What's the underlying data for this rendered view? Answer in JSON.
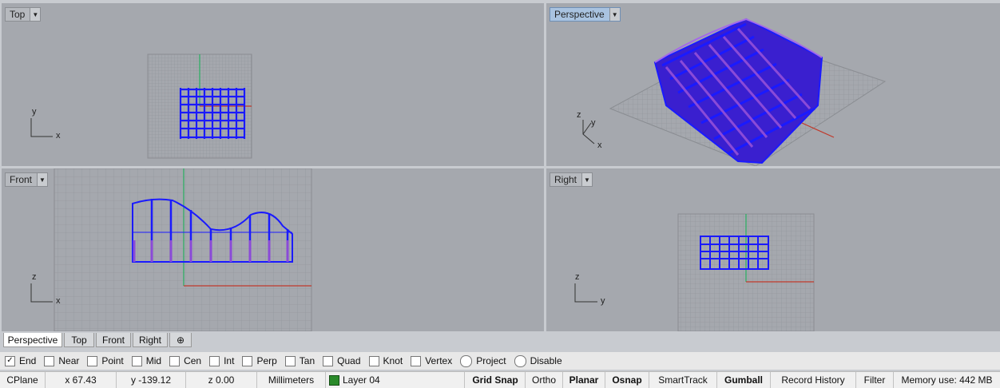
{
  "viewports": {
    "top": {
      "label": "Top",
      "axes": [
        "y",
        "x"
      ]
    },
    "perspective": {
      "label": "Perspective",
      "axes": [
        "z",
        "y",
        "x"
      ]
    },
    "front": {
      "label": "Front",
      "axes": [
        "z",
        "x"
      ]
    },
    "right": {
      "label": "Right",
      "axes": [
        "z",
        "y"
      ]
    }
  },
  "tabs": [
    {
      "label": "Perspective",
      "active": true
    },
    {
      "label": "Top",
      "active": false
    },
    {
      "label": "Front",
      "active": false
    },
    {
      "label": "Right",
      "active": false
    }
  ],
  "add_tab_icon": "plus-icon",
  "osnap": [
    {
      "label": "End",
      "checked": true,
      "kind": "checkbox"
    },
    {
      "label": "Near",
      "checked": false,
      "kind": "checkbox"
    },
    {
      "label": "Point",
      "checked": false,
      "kind": "checkbox"
    },
    {
      "label": "Mid",
      "checked": false,
      "kind": "checkbox"
    },
    {
      "label": "Cen",
      "checked": false,
      "kind": "checkbox"
    },
    {
      "label": "Int",
      "checked": false,
      "kind": "checkbox"
    },
    {
      "label": "Perp",
      "checked": false,
      "kind": "checkbox"
    },
    {
      "label": "Tan",
      "checked": false,
      "kind": "checkbox"
    },
    {
      "label": "Quad",
      "checked": false,
      "kind": "checkbox"
    },
    {
      "label": "Knot",
      "checked": false,
      "kind": "checkbox"
    },
    {
      "label": "Vertex",
      "checked": false,
      "kind": "checkbox"
    },
    {
      "label": "Project",
      "checked": false,
      "kind": "radio"
    },
    {
      "label": "Disable",
      "checked": false,
      "kind": "radio"
    }
  ],
  "status": {
    "cplane": "CPlane",
    "x": "x 67.43",
    "y": "y -139.12",
    "z": "z 0.00",
    "units": "Millimeters",
    "layer": "Layer 04",
    "layer_color": "#2a8a2a",
    "grid_snap": "Grid Snap",
    "ortho": "Ortho",
    "planar": "Planar",
    "osnap": "Osnap",
    "smarttrack": "SmartTrack",
    "gumball": "Gumball",
    "record_history": "Record History",
    "filter": "Filter",
    "memory": "Memory use: 442 MB"
  },
  "colors": {
    "viewport_bg": "#a5a8ae",
    "grid": "#8f9298",
    "model_blue": "#1a1aff",
    "model_purple": "#8a4ad8",
    "x_axis": "#c0392b",
    "y_axis": "#27ae60"
  }
}
